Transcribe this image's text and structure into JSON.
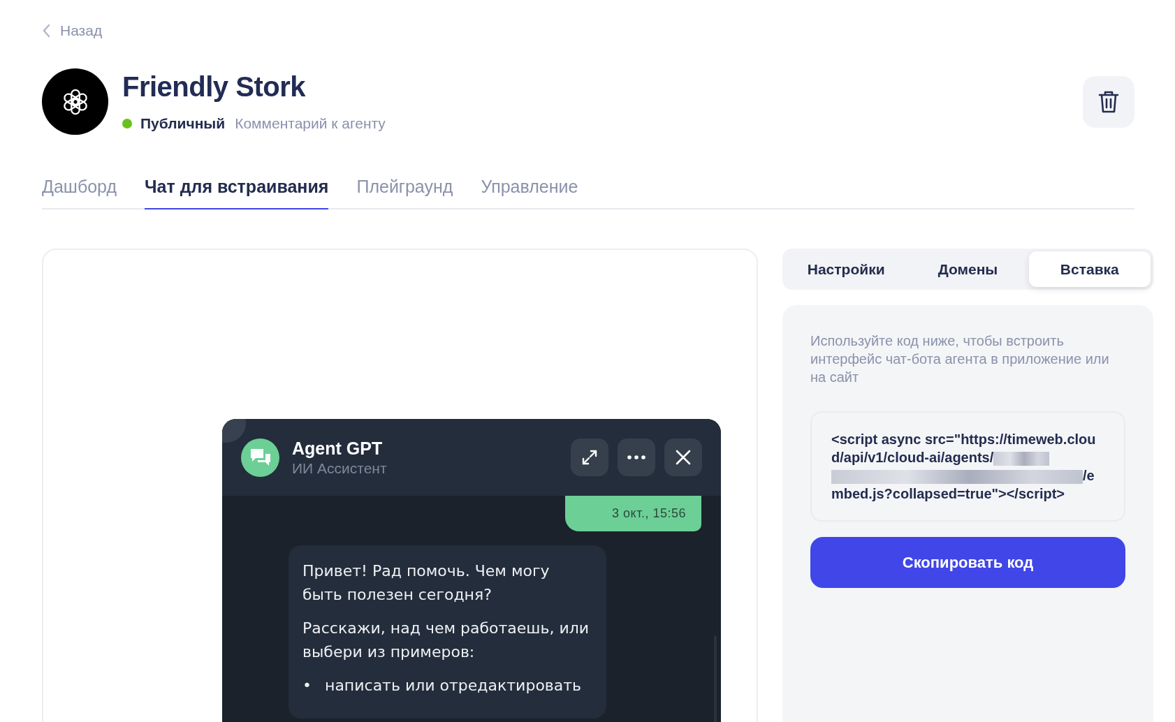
{
  "back": {
    "label": "Назад"
  },
  "agent": {
    "name": "Friendly Stork",
    "status": "Публичный",
    "comment": "Комментарий к агенту"
  },
  "tabs": [
    {
      "label": "Дашборд",
      "selected": false
    },
    {
      "label": "Чат для встраивания",
      "selected": true
    },
    {
      "label": "Плейграунд",
      "selected": false
    },
    {
      "label": "Управление",
      "selected": false
    }
  ],
  "preview": {
    "chat": {
      "title": "Agent GPT",
      "subtitle": "ИИ Ассистент",
      "timestamp": "3 окт., 15:56",
      "paragraphs": [
        "Привет! Рад помочь. Чем могу быть полезен сегодня?",
        "Расскажи, над чем работаешь, или выбери из примеров:"
      ],
      "bullets": [
        {
          "marker": "•",
          "text": "написать или отредактировать"
        }
      ]
    }
  },
  "settings_tabs": [
    {
      "label": "Настройки",
      "selected": false
    },
    {
      "label": "Домены",
      "selected": false
    },
    {
      "label": "Вставка",
      "selected": true
    }
  ],
  "embed": {
    "description": "Используйте код ниже, чтобы встроить интерфейс чат-бота агента в приложение или на сайт",
    "code": {
      "start": "<script async src=\"https://timeweb.cloud/api/v1/cloud-ai/agents/",
      "redacted": true,
      "end": "/embed.js?collapsed=true\"></script>"
    },
    "copy_button": "Скопировать код"
  }
}
